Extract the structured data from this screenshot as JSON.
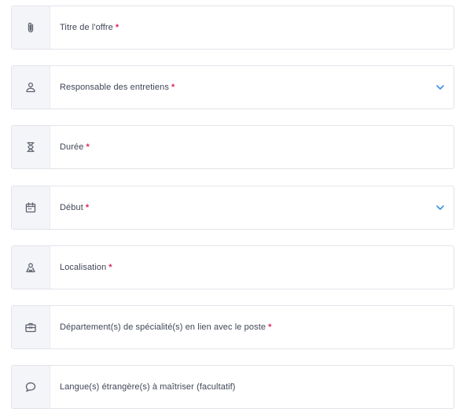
{
  "fields": [
    {
      "label": "Titre de l'offre",
      "required": "*",
      "icon": "paperclip-icon",
      "dropdown": false
    },
    {
      "label": "Responsable des entretiens",
      "required": "*",
      "icon": "user-icon",
      "dropdown": true
    },
    {
      "label": "Durée",
      "required": "*",
      "icon": "hourglass-icon",
      "dropdown": false
    },
    {
      "label": "Début",
      "required": "*",
      "icon": "calendar-icon",
      "dropdown": true
    },
    {
      "label": "Localisation",
      "required": "*",
      "icon": "map-pin-icon",
      "dropdown": false
    },
    {
      "label": "Département(s) de spécialité(s) en lien avec le poste",
      "required": "*",
      "icon": "briefcase-icon",
      "dropdown": false
    },
    {
      "label": "Langue(s) étrangère(s) à maîtriser (facultatif)",
      "required": "",
      "icon": "speech-bubble-icon",
      "dropdown": false
    }
  ],
  "colors": {
    "required": "#e0245e",
    "chevron": "#3b8fe0",
    "border": "#e1e4ea",
    "icon_bg": "#f4f5f8"
  }
}
